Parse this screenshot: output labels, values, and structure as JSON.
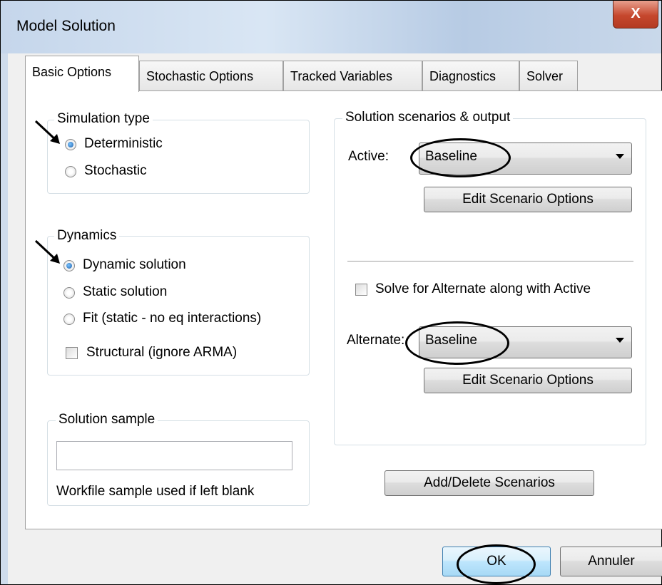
{
  "window": {
    "title": "Model Solution",
    "close_glyph": "X"
  },
  "tabs": [
    {
      "label": "Basic Options",
      "active": true
    },
    {
      "label": "Stochastic Options"
    },
    {
      "label": "Tracked Variables"
    },
    {
      "label": "Diagnostics"
    },
    {
      "label": "Solver"
    }
  ],
  "simulation_type": {
    "title": "Simulation type",
    "options": [
      {
        "label": "Deterministic",
        "selected": true
      },
      {
        "label": "Stochastic",
        "selected": false
      }
    ]
  },
  "dynamics": {
    "title": "Dynamics",
    "options": [
      {
        "label": "Dynamic solution",
        "selected": true
      },
      {
        "label": "Static solution",
        "selected": false
      },
      {
        "label": "Fit (static - no eq interactions)",
        "selected": false
      }
    ],
    "structural_label": "Structural (ignore ARMA)",
    "structural_checked": false
  },
  "solution_sample": {
    "title": "Solution sample",
    "value": "",
    "hint": "Workfile sample used if left blank"
  },
  "scenarios": {
    "title": "Solution scenarios & output",
    "active_label": "Active:",
    "active_value": "Baseline",
    "edit_button": "Edit Scenario Options",
    "solve_alt_label": "Solve for Alternate along with Active",
    "solve_alt_checked": false,
    "alternate_label": "Alternate:",
    "alternate_value": "Baseline",
    "edit_button_2": "Edit Scenario Options"
  },
  "add_delete_button": "Add/Delete Scenarios",
  "footer": {
    "ok": "OK",
    "cancel": "Annuler"
  },
  "icons": [
    "close-icon",
    "arrow-pointer-icon",
    "dropdown-arrow-icon"
  ]
}
